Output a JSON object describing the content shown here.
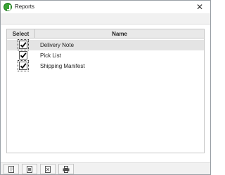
{
  "window": {
    "title": "Reports",
    "close_glyph": "✕"
  },
  "grid": {
    "columns": [
      "Select",
      "Name"
    ],
    "rows": [
      {
        "name": "Delivery Note",
        "checked": true,
        "selected": true
      },
      {
        "name": "Pick List",
        "checked": true,
        "selected": false
      },
      {
        "name": "Shipping Manifest",
        "checked": true,
        "selected": false
      }
    ]
  },
  "toolbar": {
    "buttons": [
      {
        "icon": "export-pdf-icon"
      },
      {
        "icon": "export-word-icon"
      },
      {
        "icon": "export-excel-icon"
      },
      {
        "icon": "print-icon"
      }
    ]
  },
  "colors": {
    "app_icon": "#3aa335",
    "header_bg": "#e9e9e9",
    "selected_row_bg": "#e4e4e4"
  }
}
